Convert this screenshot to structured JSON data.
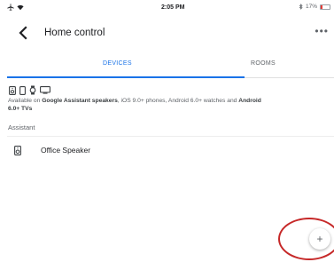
{
  "status_bar": {
    "time": "2:05 PM",
    "battery": "17%",
    "battery_level": 0.17
  },
  "header": {
    "title": "Home control",
    "back_icon": "back-arrow-icon",
    "more_label": "•••"
  },
  "tabs": [
    {
      "label": "DEVICES",
      "selected": true
    },
    {
      "label": "ROOMS",
      "selected": false
    }
  ],
  "availability": {
    "prefix": "Available on ",
    "emphasis1": "Google Assistant speakers",
    "mid1": ", iOS 9.0+ phones, Android 6.0+ watches",
    "mid2": " and ",
    "emphasis2": "Android 6.0+ TVs"
  },
  "section": {
    "label": "Assistant"
  },
  "devices": [
    {
      "name": "Office Speaker",
      "icon": "speaker-icon"
    }
  ],
  "fab": {
    "label": "+"
  },
  "colors": {
    "accent": "#1a73e8",
    "highlight": "#c62828",
    "battery_low": "#e53935"
  }
}
